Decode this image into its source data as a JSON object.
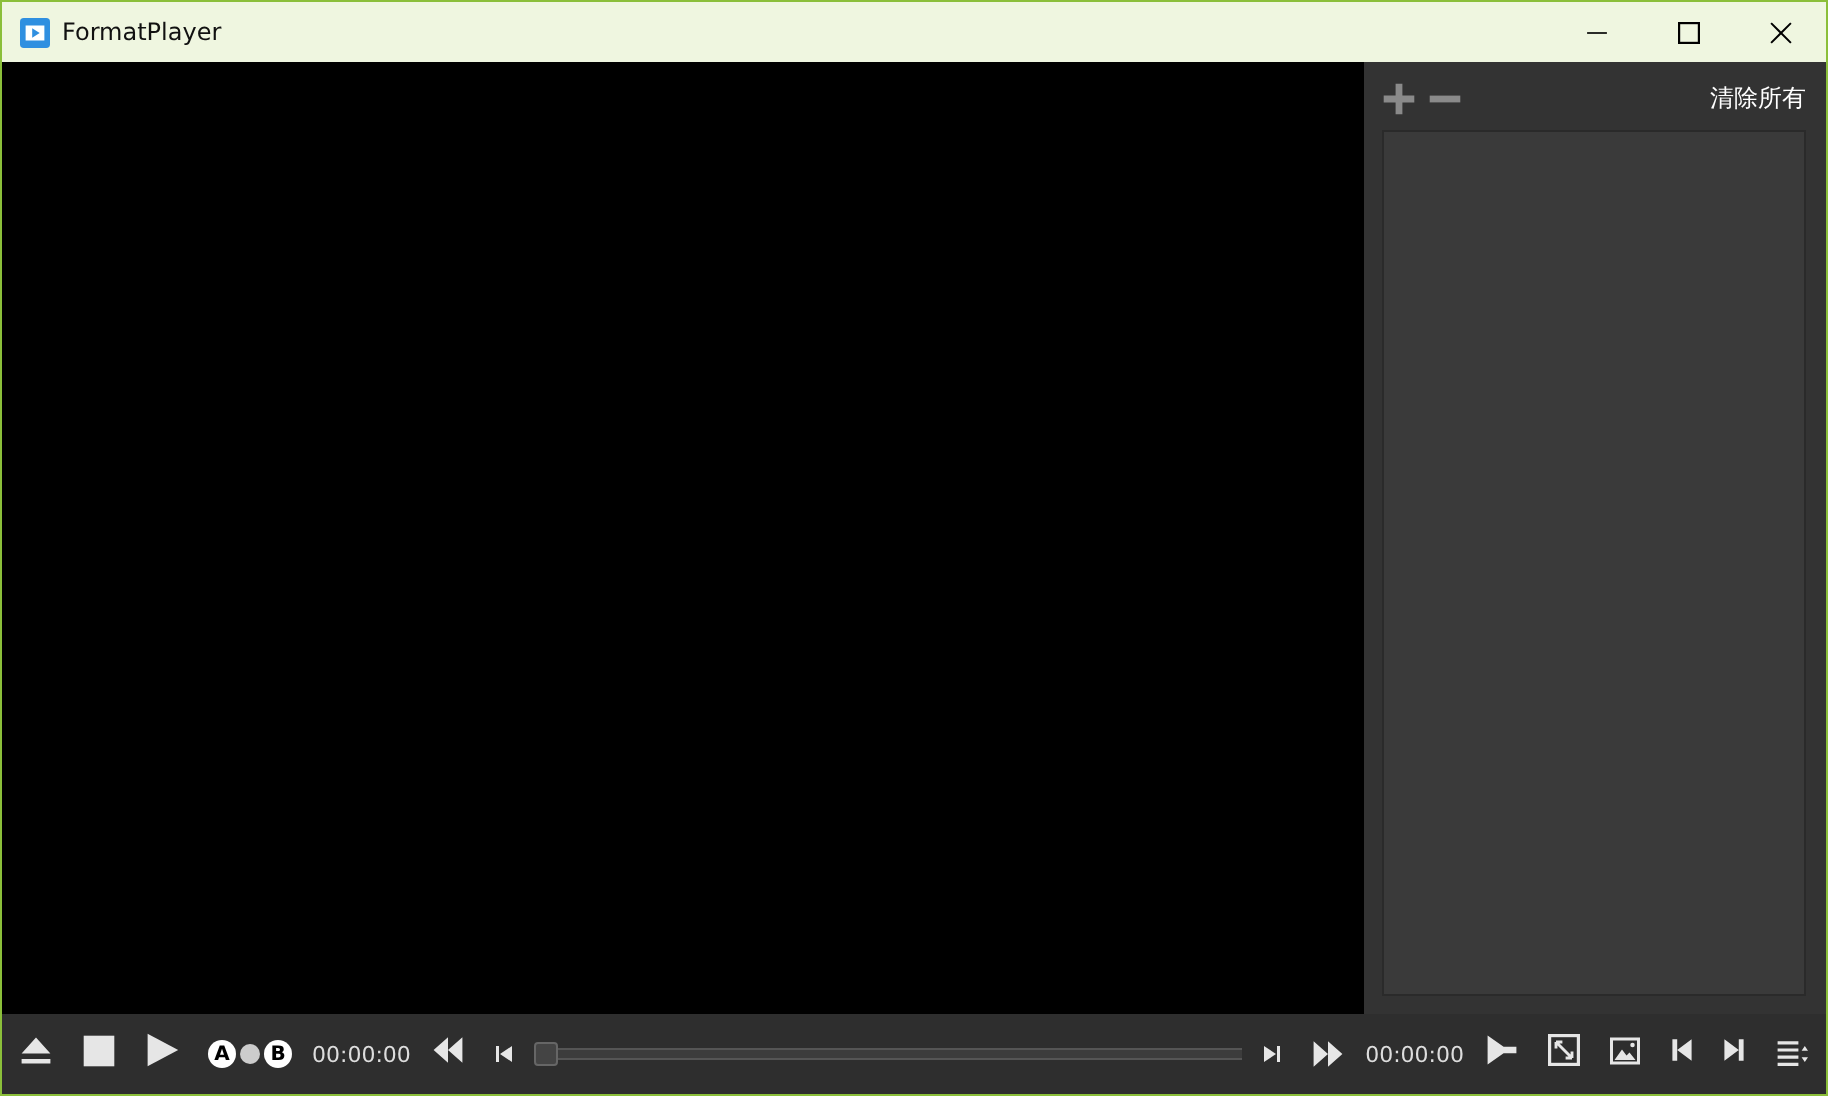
{
  "window": {
    "title": "FormatPlayer"
  },
  "playlist": {
    "clear_label": "清除所有"
  },
  "controls": {
    "ab_a": "A",
    "ab_b": "B",
    "current_time": "00:00:00",
    "seek": {
      "level": 0
    },
    "total_time": "00:00:00"
  }
}
